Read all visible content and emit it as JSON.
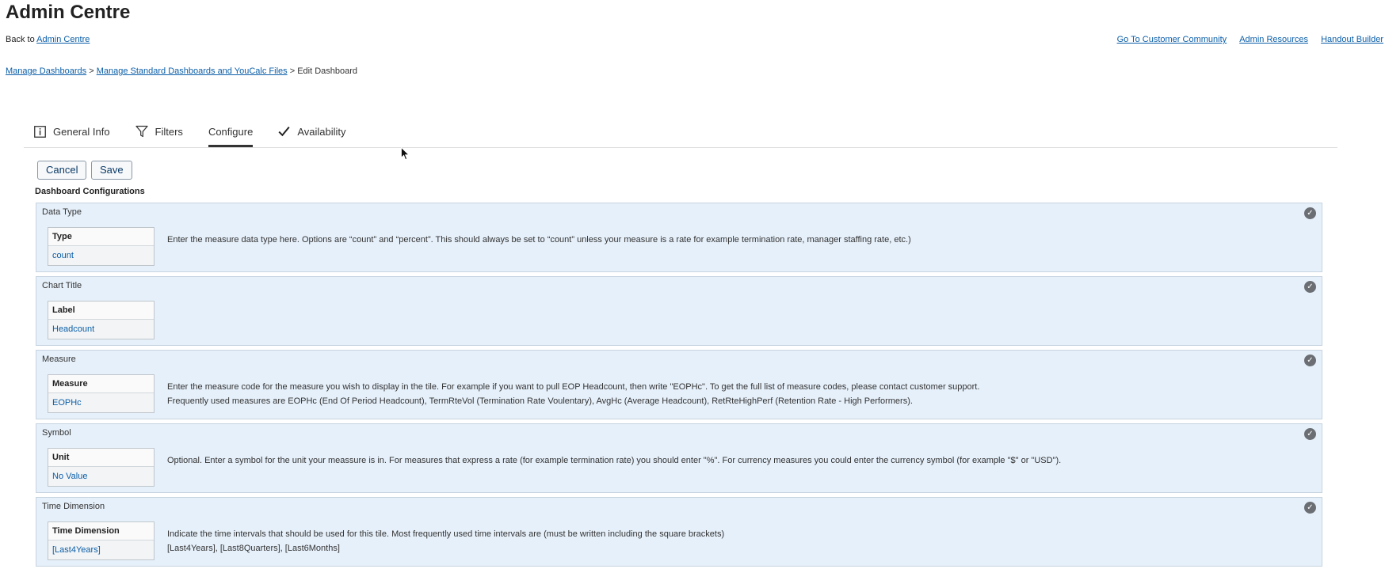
{
  "header": {
    "title": "Admin Centre",
    "back_prefix": "Back to",
    "back_link": "Admin Centre",
    "links": [
      "Go To Customer Community",
      "Admin Resources",
      "Handout Builder"
    ]
  },
  "breadcrumb": {
    "items": [
      "Manage Dashboards",
      "Manage Standard Dashboards and YouCalc Files"
    ],
    "separator": ">",
    "current": "Edit Dashboard"
  },
  "tabs": [
    {
      "label": "General Info",
      "icon": "info-icon"
    },
    {
      "label": "Filters",
      "icon": "filter-icon"
    },
    {
      "label": "Configure",
      "icon": "",
      "active": true
    },
    {
      "label": "Availability",
      "icon": "checkmark-icon"
    }
  ],
  "actions": {
    "cancel": "Cancel",
    "save": "Save"
  },
  "section_title": "Dashboard Configurations",
  "configs": [
    {
      "title": "Data Type",
      "field_label": "Type",
      "value": "count",
      "desc1": "Enter the measure data type here. Options are “count” and “percent”. This should always be set to “count” unless your measure is a rate for example termination rate, manager staffing rate, etc.)",
      "desc2": ""
    },
    {
      "title": "Chart Title",
      "field_label": "Label",
      "value": "Headcount",
      "desc1": "",
      "desc2": ""
    },
    {
      "title": "Measure",
      "field_label": "Measure",
      "value": "EOPHc",
      "desc1": "Enter the measure code for the measure you wish to display in the tile. For example if you want to pull EOP Headcount, then write \"EOPHc\". To get the full list of measure codes, please contact customer support.",
      "desc2": "Frequently used measures are EOPHc (End Of Period Headcount), TermRteVol (Termination Rate Voulentary), AvgHc (Average Headcount), RetRteHighPerf (Retention Rate - High Performers)."
    },
    {
      "title": "Symbol",
      "field_label": "Unit",
      "value": "No Value",
      "desc1": "Optional. Enter a symbol for the unit your meassure is in. For measures that express a rate (for example termination rate) you should enter \"%\". For currency measures you could enter the currency symbol (for example \"$\" or \"USD\").",
      "desc2": ""
    },
    {
      "title": "Time Dimension",
      "field_label": "Time Dimension",
      "value": "[Last4Years]",
      "desc1": "Indicate the time intervals that should be used for this tile. Most frequently used time intervals are (must be written including the square brackets)",
      "desc2": "[Last4Years], [Last8Quarters], [Last6Months]"
    }
  ],
  "colors": {
    "link": "#0b5ea8",
    "panel_bg": "#e6f0fa",
    "panel_border": "#c6d3e0",
    "check_bg": "#6b6f74"
  }
}
